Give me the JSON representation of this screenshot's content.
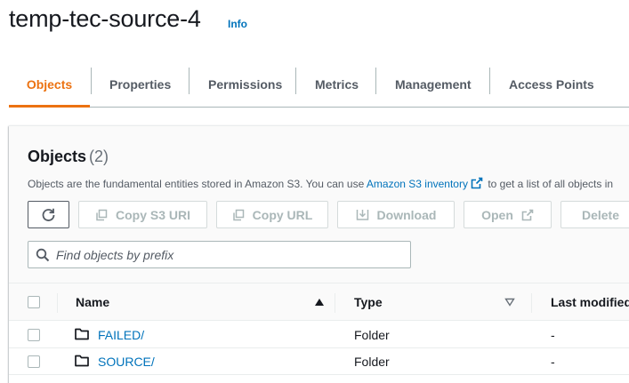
{
  "header": {
    "title": "temp-tec-source-4",
    "info_link": "Info"
  },
  "tabs": [
    {
      "label": "Objects",
      "active": true
    },
    {
      "label": "Properties"
    },
    {
      "label": "Permissions"
    },
    {
      "label": "Metrics"
    },
    {
      "label": "Management"
    },
    {
      "label": "Access Points"
    }
  ],
  "objects_panel": {
    "title": "Objects",
    "count": "(2)",
    "description_prefix": "Objects are the fundamental entities stored in Amazon S3. You can use ",
    "description_link": "Amazon S3 inventory",
    "description_suffix": " to get a list of all objects in",
    "buttons": {
      "refresh": "refresh-icon",
      "copy_s3_uri": "Copy S3 URI",
      "copy_url": "Copy URL",
      "download": "Download",
      "open": "Open",
      "delete": "Delete"
    },
    "search": {
      "placeholder": "Find objects by prefix",
      "value": ""
    }
  },
  "table": {
    "columns": {
      "name": "Name",
      "type": "Type",
      "last_modified": "Last modified"
    },
    "rows": [
      {
        "name": "FAILED/",
        "type": "Folder",
        "last_modified": "-"
      },
      {
        "name": "SOURCE/",
        "type": "Folder",
        "last_modified": "-"
      }
    ]
  },
  "colors": {
    "accent": "#ec7211",
    "link": "#0073bb",
    "text": "#16191f",
    "muted": "#545b64",
    "disabled": "#aab7b8"
  }
}
